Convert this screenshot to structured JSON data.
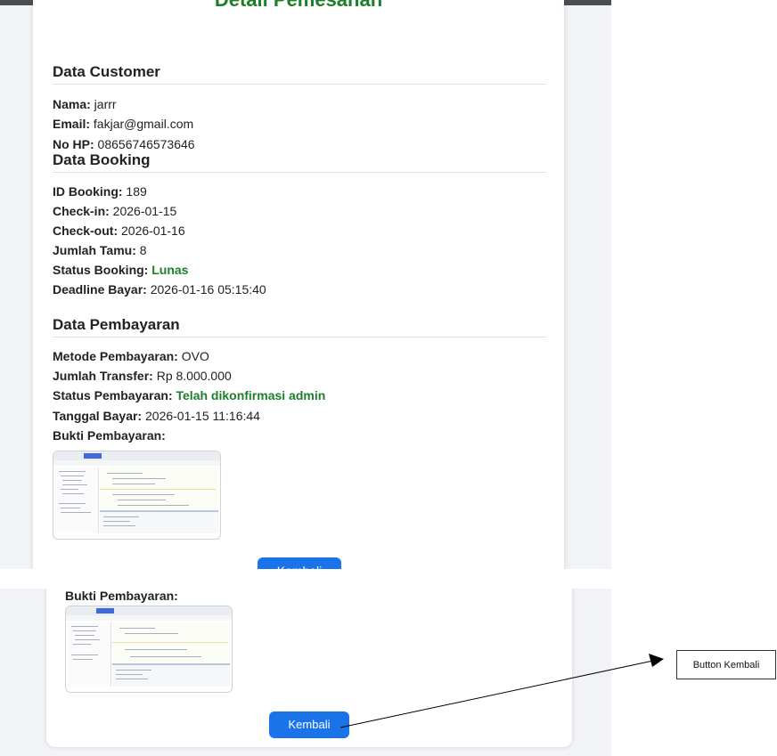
{
  "top": {
    "title": "Detail Pemesanan",
    "customer": {
      "heading": "Data Customer",
      "rows": [
        {
          "label": "Nama:",
          "value": " jarrr"
        },
        {
          "label": "Email:",
          "value": " fakjar@gmail.com"
        },
        {
          "label": "No HP:",
          "value": " 08656746573646"
        }
      ]
    },
    "booking": {
      "heading": "Data Booking",
      "rows": [
        {
          "label": "ID Booking:",
          "value": " 189"
        },
        {
          "label": "Check-in:",
          "value": " 2026-01-15"
        },
        {
          "label": "Check-out:",
          "value": " 2026-01-16"
        },
        {
          "label": "Jumlah Tamu:",
          "value": " 8"
        },
        {
          "label": "Status Booking:",
          "value": "Lunas"
        },
        {
          "label": "Deadline Bayar:",
          "value": " 2026-01-16 05:15:40"
        }
      ]
    },
    "payment": {
      "heading": "Data Pembayaran",
      "rows": [
        {
          "label": "Metode Pembayaran:",
          "value": " OVO"
        },
        {
          "label": "Jumlah Transfer:",
          "value": " Rp 8.000.000"
        },
        {
          "label": "Status Pembayaran:",
          "value": "Telah dikonfirmasi admin"
        },
        {
          "label": "Tanggal Bayar:",
          "value": " 2026-01-15 11:16:44"
        }
      ],
      "proof_label": "Bukti Pembayaran:"
    },
    "button_partial": "Kembali"
  },
  "bottom": {
    "proof_label": "Bukti Pembayaran:",
    "button": "Kembali"
  },
  "annotation": {
    "label": "Button Kembali"
  },
  "colors": {
    "accent_green": "#1e7f2a",
    "button_blue": "#1a73e8"
  }
}
